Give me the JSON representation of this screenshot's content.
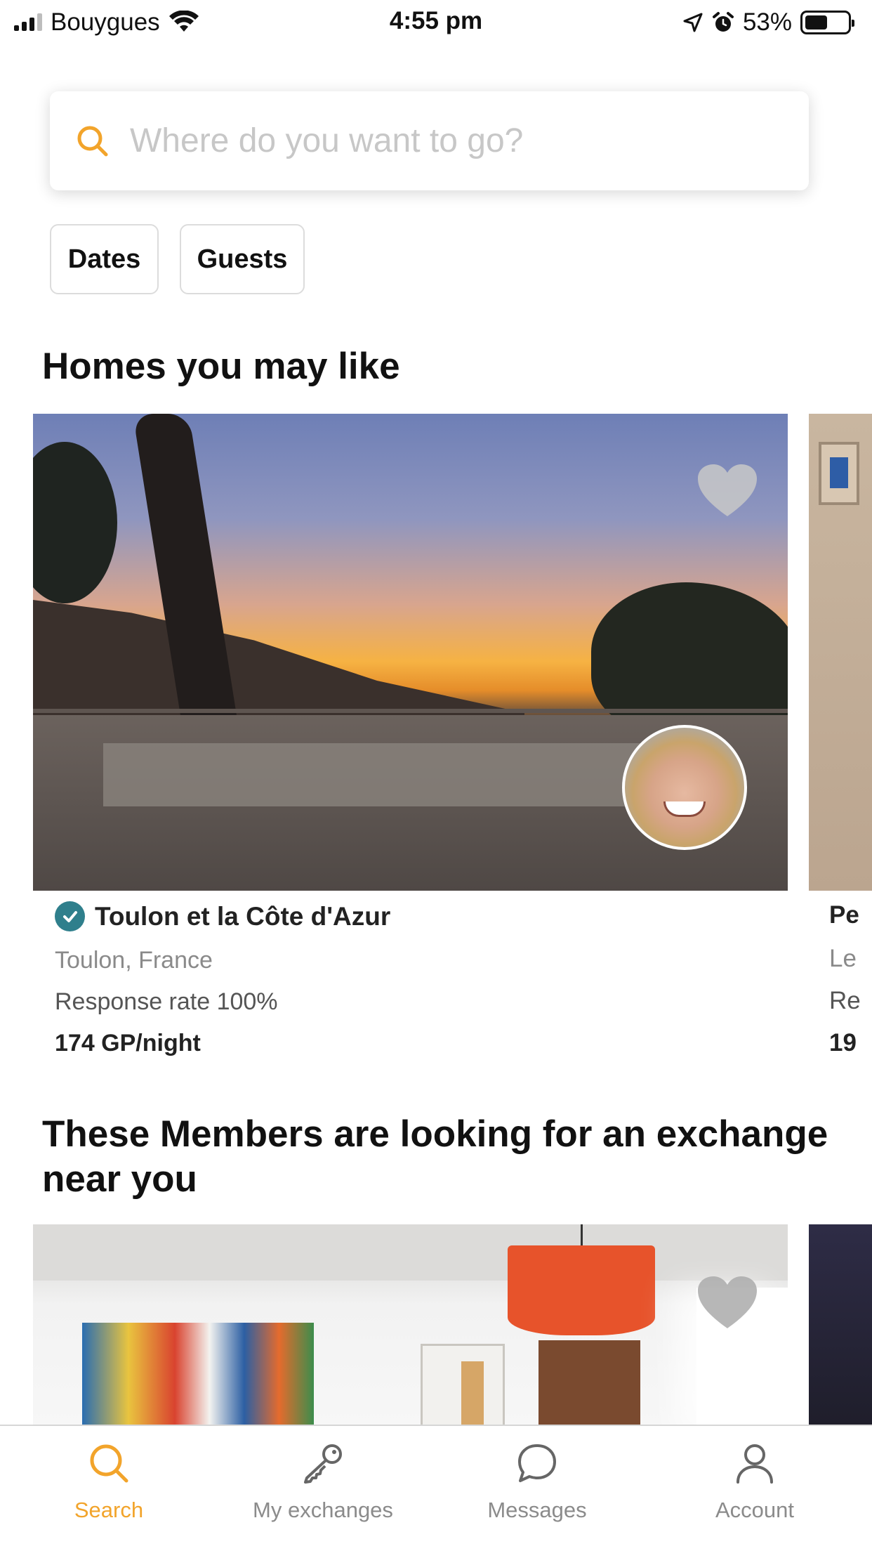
{
  "status_bar": {
    "carrier": "Bouygues",
    "time": "4:55 pm",
    "battery_percent": "53%",
    "battery_level": 0.53
  },
  "search": {
    "placeholder": "Where do you want to go?"
  },
  "filters": {
    "dates_label": "Dates",
    "guests_label": "Guests"
  },
  "sections": {
    "homes_title": "Homes you may like",
    "members_title": "These Members are looking for an exchange near you"
  },
  "homes": [
    {
      "title": "Toulon et la Côte d'Azur",
      "location": "Toulon, France",
      "response_rate": "Response rate 100%",
      "price": "174 GP/night",
      "verified": true
    },
    {
      "title": "Pe",
      "location": "Le",
      "response_rate": "Re",
      "price": "19"
    }
  ],
  "tab_bar": {
    "items": [
      {
        "label": "Search",
        "icon": "search-icon",
        "active": true
      },
      {
        "label": "My exchanges",
        "icon": "key-icon",
        "active": false
      },
      {
        "label": "Messages",
        "icon": "chat-bubble-icon",
        "active": false
      },
      {
        "label": "Account",
        "icon": "person-icon",
        "active": false
      }
    ]
  },
  "colors": {
    "accent": "#f2a42b",
    "verified_badge": "#2f7f8c",
    "muted_text": "#8b8b8b"
  }
}
